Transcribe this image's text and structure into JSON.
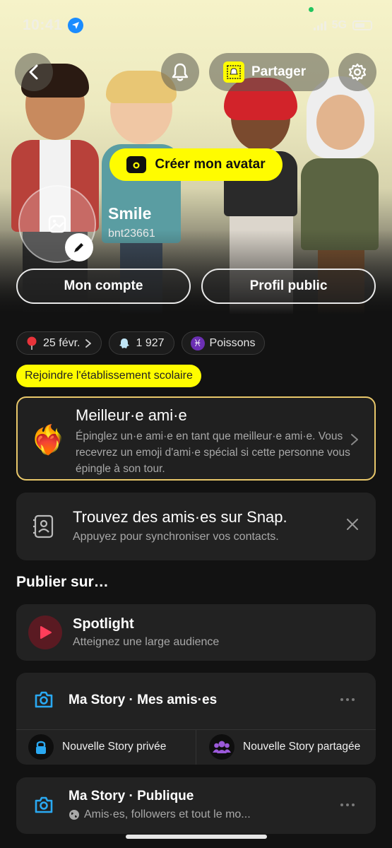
{
  "status_bar": {
    "time": "10:41",
    "network": "5G"
  },
  "header": {
    "share_label": "Partager"
  },
  "hero": {
    "create_avatar_label": "Créer mon avatar"
  },
  "profile": {
    "display_name": "Smile",
    "username": "bnt23661"
  },
  "buttons": {
    "my_account": "Mon compte",
    "public_profile": "Profil public"
  },
  "chips": [
    {
      "label": "25 févr.",
      "icon": "pin-icon"
    },
    {
      "label": "1 927",
      "icon": "ghost-icon"
    },
    {
      "label": "Poissons",
      "icon": "pisces-icon"
    }
  ],
  "school": {
    "label": "Rejoindre l'établissement scolaire"
  },
  "best_friend": {
    "title": "Meilleur·e ami·e",
    "description": "Épinglez un·e ami·e en tant que meilleur·e ami·e. Vous recevrez un emoji d'ami·e spécial si cette personne vous épingle à son tour."
  },
  "find_friends": {
    "title": "Trouvez des amis·es sur Snap.",
    "description": "Appuyez pour synchroniser vos contacts."
  },
  "publish": {
    "section_title": "Publier sur…"
  },
  "spotlight": {
    "title": "Spotlight",
    "description": "Atteignez une large audience"
  },
  "my_story_friends": {
    "title": "Ma Story · Mes amis·es",
    "private_story": "Nouvelle Story privée",
    "shared_story": "Nouvelle Story partagée"
  },
  "my_story_public": {
    "title": "Ma Story · Publique",
    "description": "Amis·es, followers et tout le mo..."
  },
  "colors": {
    "snap_yellow": "#fffc00",
    "background": "#121212",
    "card": "#222222",
    "bff_border": "#e8c76a"
  }
}
